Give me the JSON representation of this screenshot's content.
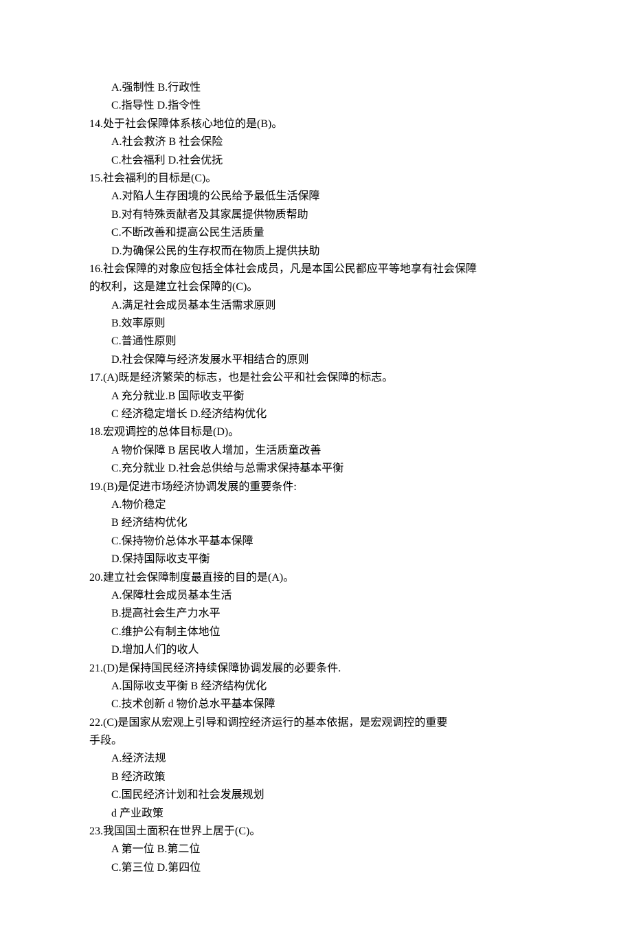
{
  "lines": [
    {
      "cls": "option-line",
      "text": "A.强制性 B.行政性"
    },
    {
      "cls": "option-line",
      "text": "C.指导性 D.指令性"
    },
    {
      "cls": "question-text",
      "text": "14.处于社会保障体系核心地位的是(B)。"
    },
    {
      "cls": "option-line",
      "text": "A.社会救济 B 社会保险"
    },
    {
      "cls": "option-line",
      "text": "C.杜会福利 D.社会优抚"
    },
    {
      "cls": "question-text",
      "text": "15.社会福利的目标是(C)。"
    },
    {
      "cls": "option-line",
      "text": "A.对陷人生存困境的公民给予最低生活保障"
    },
    {
      "cls": "option-line",
      "text": "B.对有特殊贡献者及其家属提供物质帮助"
    },
    {
      "cls": "option-line",
      "text": "C.不断改善和提高公民生活质量"
    },
    {
      "cls": "option-line",
      "text": "D.为确保公民的生存权而在物质上提供扶助"
    },
    {
      "cls": "question-text",
      "text": "16.社会保障的对象应包括全体社会成员，凡是本国公民都应平等地享有社会保障"
    },
    {
      "cls": "continuation",
      "text": "的权利，这是建立社会保障的(C)。"
    },
    {
      "cls": "option-line",
      "text": "A.满足社会成员基本生活需求原则"
    },
    {
      "cls": "option-line",
      "text": "B.效率原则"
    },
    {
      "cls": "option-line",
      "text": "C.普通性原则"
    },
    {
      "cls": "option-line",
      "text": "D.社会保障与经济发展水平相结合的原则"
    },
    {
      "cls": "question-text",
      "text": "17.(A)既是经济繁荣的标志，也是社会公平和社会保障的标志。"
    },
    {
      "cls": "option-line",
      "text": "A 充分就业.B 国际收支平衡"
    },
    {
      "cls": "option-line",
      "text": "C 经济稳定增长 D.经济结构优化"
    },
    {
      "cls": "question-text",
      "text": "18.宏观调控的总体目标是(D)。"
    },
    {
      "cls": "option-line",
      "text": "A 物价保障  B 居民收人增加，生活质童改善"
    },
    {
      "cls": "option-line",
      "text": "C.充分就业 D.社会总供给与总需求保持基本平衡"
    },
    {
      "cls": "question-text",
      "text": "19.(B)是促进市场经济协调发展的重要条件:"
    },
    {
      "cls": "option-line",
      "text": "A.物价稳定"
    },
    {
      "cls": "option-line",
      "text": "B 经济结构优化"
    },
    {
      "cls": "option-line",
      "text": "C.保持物价总体水平基本保障"
    },
    {
      "cls": "option-line",
      "text": "D.保持国际收支平衡"
    },
    {
      "cls": "question-text",
      "text": "20.建立社会保障制度最直接的目的是(A)。"
    },
    {
      "cls": "option-line",
      "text": "A.保障杜会成员基本生活"
    },
    {
      "cls": "option-line",
      "text": "B.提高社会生产力水平"
    },
    {
      "cls": "option-line",
      "text": "C.维护公有制主体地位"
    },
    {
      "cls": "option-line",
      "text": "D.增加人们的收人"
    },
    {
      "cls": "question-text",
      "text": "21.(D)是保持国民经济持续保障协调发展的必要条件."
    },
    {
      "cls": "option-line",
      "text": "A.国际收支平衡 B 经济结构优化"
    },
    {
      "cls": "option-line",
      "text": "C.技术创新 d 物价总水平基本保障"
    },
    {
      "cls": "question-text",
      "text": "22.(C)是国家从宏观上引导和调控经济运行的基本依据，是宏观调控的重要"
    },
    {
      "cls": "continuation",
      "text": "手段。"
    },
    {
      "cls": "option-line",
      "text": "A.经济法规"
    },
    {
      "cls": "option-line",
      "text": "B 经济政策"
    },
    {
      "cls": "option-line",
      "text": "C.国民经济计划和社会发展规划"
    },
    {
      "cls": "option-line",
      "text": "d 产业政策"
    },
    {
      "cls": "question-text",
      "text": "23.我国国土面积在世界上居于(C)。"
    },
    {
      "cls": "option-line",
      "text": "A 第一位 B.第二位"
    },
    {
      "cls": "option-line",
      "text": "C.第三位 D.第四位"
    }
  ]
}
